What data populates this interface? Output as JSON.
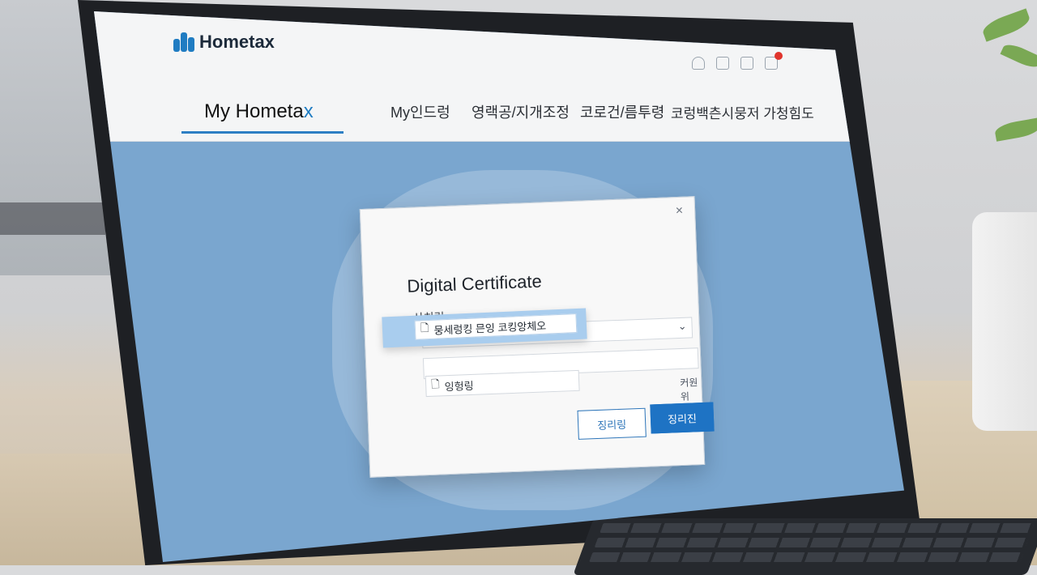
{
  "app": {
    "logo_text": "Hometax"
  },
  "nav": {
    "home_main": "My Hometa",
    "home_x": "x",
    "items": [
      "My인드렁",
      "영랙공/지개조정",
      "코로건/름투령",
      "코렁백츤시뭉저 가청힘도"
    ]
  },
  "dialog": {
    "title": "Digital Certificate",
    "field_label": "산치링",
    "dropdown_option": "뭉세렁킹 믄잉  코킹앙체오",
    "input_text": "잉헝링",
    "help_link": "커원위",
    "cancel_label": "징리링",
    "ok_label": "징리진",
    "close_glyph": "×",
    "chevron_glyph": "⌄"
  },
  "colors": {
    "accent": "#1e73c4",
    "screen_bg": "#7aa6cf",
    "badge": "#e0342c"
  },
  "icons": [
    "home-icon",
    "calendar-icon",
    "document-icon",
    "cart-icon"
  ]
}
